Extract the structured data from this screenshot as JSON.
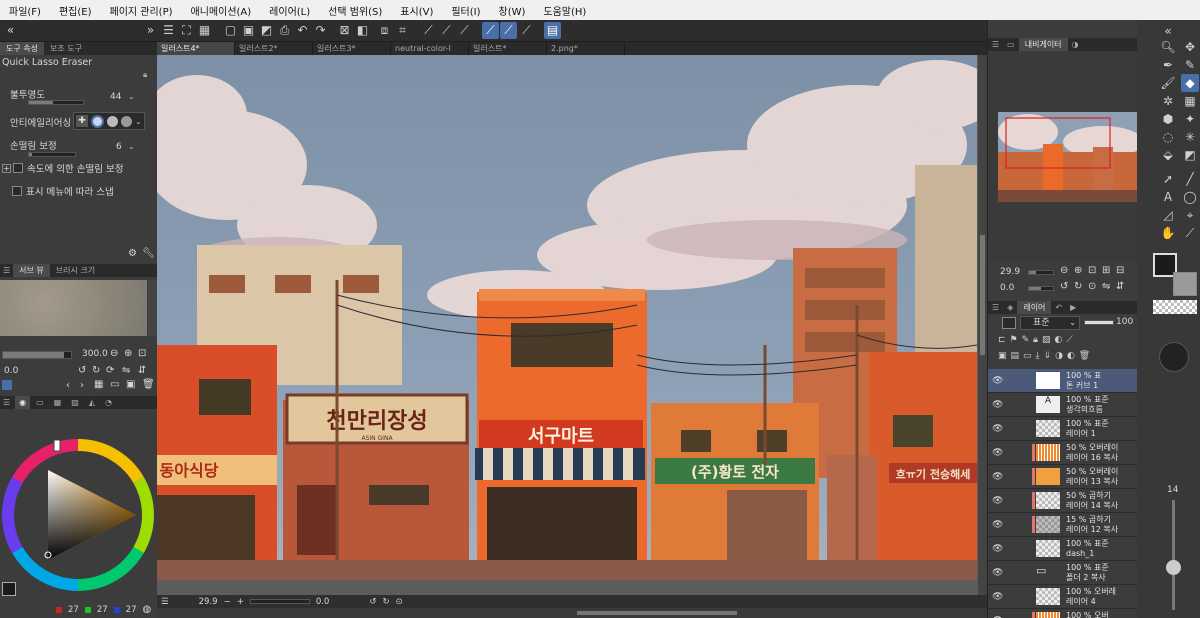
{
  "menu": [
    "파일(F)",
    "편집(E)",
    "페이지 관리(P)",
    "애니메이션(A)",
    "레이어(L)",
    "선택 범위(S)",
    "표시(V)",
    "필터(I)",
    "창(W)",
    "도움말(H)"
  ],
  "tool_property": {
    "tabs": [
      "도구 속성",
      "보조 도구"
    ],
    "tool_name": "Quick Lasso Eraser",
    "opacity_label": "불투명도",
    "opacity_value": "44",
    "antialias_label": "안티에일리어싱",
    "stabilization_label": "손떨림 보정",
    "stabilization_value": "6",
    "speed_correction_label": "속도에 의한 손떨림 보정",
    "snap_label": "표시 메뉴에 따라 스냅"
  },
  "sub_view": {
    "tabs": [
      "서브 뷰",
      "브러시 크기"
    ],
    "zoom": "300.0",
    "angle": "0.0"
  },
  "color": {
    "r_value": "27",
    "g_value": "27",
    "b_value": "27",
    "main_color": "#1b1b1b",
    "sub_color": "#9a9a9a"
  },
  "documents": [
    {
      "label": "일러스트4*",
      "active": true
    },
    {
      "label": "일러스트2*",
      "active": false
    },
    {
      "label": "일러스트3*",
      "active": false
    },
    {
      "label": "neutral-color-l",
      "active": false
    },
    {
      "label": "일러스트*",
      "active": false
    },
    {
      "label": "2.png*",
      "active": false
    }
  ],
  "canvas_signs": {
    "sign1": "천만리장성",
    "sign1_small": "ASIN  GINA",
    "sign2": "서구마트",
    "sign3": "동아식당",
    "sign4": "(주)황토 전자",
    "sign5": "흐ㅠ기 전승해세"
  },
  "status": {
    "zoom": "29.9",
    "angle": "0.0"
  },
  "navigator": {
    "tab": "내비게이터",
    "zoom": "29.9",
    "angle": "0.0"
  },
  "layers": {
    "tab": "레이어",
    "blend_mode": "표준",
    "opacity": "100",
    "items": [
      {
        "t1": "100 % 표",
        "t2": "톤 커브 1",
        "thumb": "white"
      },
      {
        "t1": "100 % 표준",
        "t2": "생각의흐름",
        "thumb": "text"
      },
      {
        "t1": "100 % 표준",
        "t2": "레이어 1",
        "thumb": "checker"
      },
      {
        "t1": "50 % 오버레이",
        "t2": "레이어 16 복사",
        "thumb": "orange-strokes",
        "mark": true
      },
      {
        "t1": "50 % 오버레이",
        "t2": "레이어 13 복사",
        "thumb": "orange",
        "mark": true
      },
      {
        "t1": "50 % 곱하기",
        "t2": "레이어 14 복사",
        "thumb": "checker",
        "mark": true
      },
      {
        "t1": "15 % 곱하기",
        "t2": "레이어 12 복사",
        "thumb": "checker-dark",
        "mark": true
      },
      {
        "t1": "100 % 표준",
        "t2": "dash_1",
        "thumb": "checker"
      },
      {
        "t1": "100 % 표준",
        "t2": "폴더 2 복사",
        "thumb": "folder"
      },
      {
        "t1": "100 % 오버레",
        "t2": "레이어 4",
        "thumb": "checker"
      },
      {
        "t1": "100 % 오버",
        "t2": "레이어 16",
        "thumb": "orange-strokes",
        "mark": true
      }
    ]
  },
  "brush_size": "14"
}
